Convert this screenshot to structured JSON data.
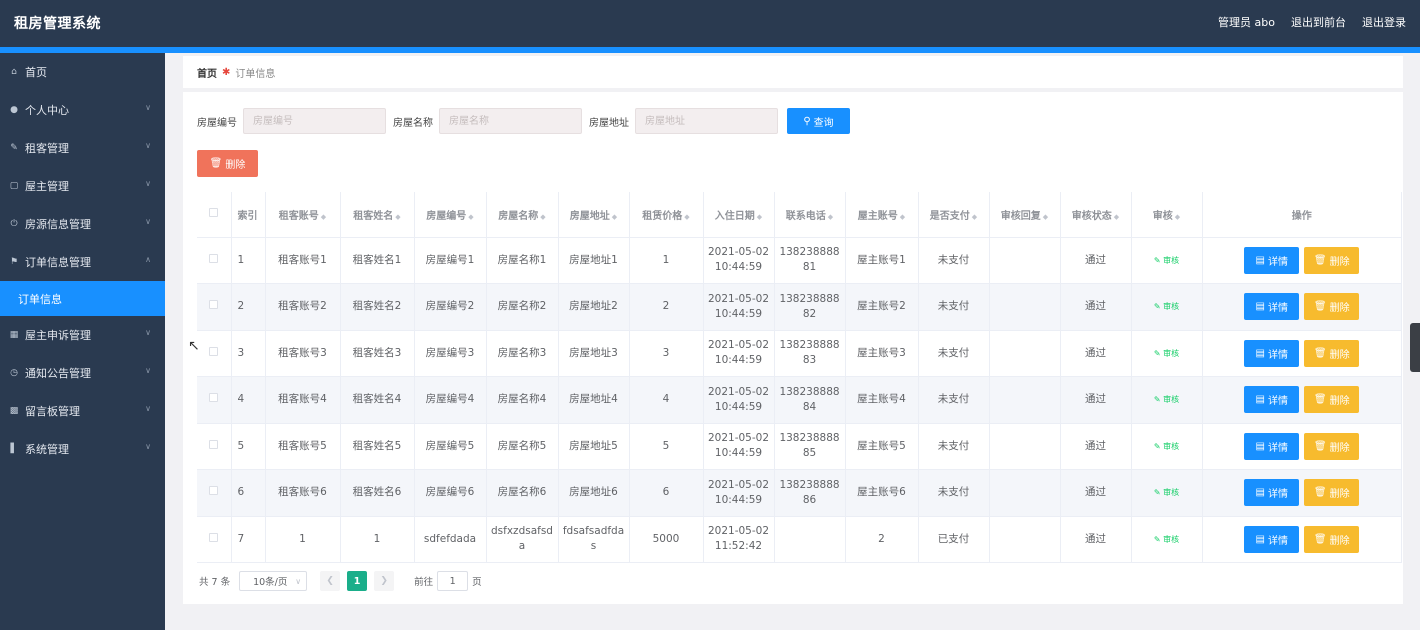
{
  "app": {
    "title": "租房管理系统"
  },
  "topbar": {
    "user": "管理员 abo",
    "to_front": "退出到前台",
    "logout": "退出登录"
  },
  "sidebar": {
    "items": [
      {
        "label": "首页",
        "icon": "home-icon"
      },
      {
        "label": "个人中心",
        "icon": "user-icon"
      },
      {
        "label": "租客管理",
        "icon": "pen-icon"
      },
      {
        "label": "屋主管理",
        "icon": "chat-icon"
      },
      {
        "label": "房源信息管理",
        "icon": "power-icon"
      },
      {
        "label": "订单信息管理",
        "icon": "flag-icon"
      },
      {
        "label": "屋主申诉管理",
        "icon": "grid-icon"
      },
      {
        "label": "通知公告管理",
        "icon": "clock-icon"
      },
      {
        "label": "留言板管理",
        "icon": "board-icon"
      },
      {
        "label": "系统管理",
        "icon": "chart-icon"
      }
    ],
    "active_sub": "订单信息"
  },
  "breadcrumb": {
    "home": "首页",
    "current": "订单信息"
  },
  "search": {
    "f1_label": "房屋编号",
    "f1_placeholder": "房屋编号",
    "f2_label": "房屋名称",
    "f2_placeholder": "房屋名称",
    "f3_label": "房屋地址",
    "f3_placeholder": "房屋地址",
    "query_label": "查询"
  },
  "delete_label": "删除",
  "table": {
    "headers": [
      "索引",
      "租客账号",
      "租客姓名",
      "房屋编号",
      "房屋名称",
      "房屋地址",
      "租赁价格",
      "入住日期",
      "联系电话",
      "屋主账号",
      "是否支付",
      "审核回复",
      "审核状态",
      "审核",
      "操作"
    ],
    "audit_label": "审核",
    "detail_label": "详情",
    "delete_label": "删除",
    "rows": [
      [
        "1",
        "租客账号1",
        "租客姓名1",
        "房屋编号1",
        "房屋名称1",
        "房屋地址1",
        "1",
        "2021-05-02 10:44:59",
        "13823888881",
        "屋主账号1",
        "未支付",
        "",
        "通过"
      ],
      [
        "2",
        "租客账号2",
        "租客姓名2",
        "房屋编号2",
        "房屋名称2",
        "房屋地址2",
        "2",
        "2021-05-02 10:44:59",
        "13823888882",
        "屋主账号2",
        "未支付",
        "",
        "通过"
      ],
      [
        "3",
        "租客账号3",
        "租客姓名3",
        "房屋编号3",
        "房屋名称3",
        "房屋地址3",
        "3",
        "2021-05-02 10:44:59",
        "13823888883",
        "屋主账号3",
        "未支付",
        "",
        "通过"
      ],
      [
        "4",
        "租客账号4",
        "租客姓名4",
        "房屋编号4",
        "房屋名称4",
        "房屋地址4",
        "4",
        "2021-05-02 10:44:59",
        "13823888884",
        "屋主账号4",
        "未支付",
        "",
        "通过"
      ],
      [
        "5",
        "租客账号5",
        "租客姓名5",
        "房屋编号5",
        "房屋名称5",
        "房屋地址5",
        "5",
        "2021-05-02 10:44:59",
        "13823888885",
        "屋主账号5",
        "未支付",
        "",
        "通过"
      ],
      [
        "6",
        "租客账号6",
        "租客姓名6",
        "房屋编号6",
        "房屋名称6",
        "房屋地址6",
        "6",
        "2021-05-02 10:44:59",
        "13823888886",
        "屋主账号6",
        "未支付",
        "",
        "通过"
      ],
      [
        "7",
        "1",
        "1",
        "sdfefdada",
        "dsfxzdsafsda",
        "fdsafsadfdas",
        "5000",
        "2021-05-02 11:52:42",
        "",
        "2",
        "已支付",
        "",
        "通过"
      ]
    ]
  },
  "pager": {
    "total": "共 7 条",
    "size": "10条/页",
    "page": "1",
    "goto": "前往",
    "goto_value": "1",
    "page_unit": "页"
  },
  "colors": {
    "topbar": "#2a3a50",
    "accent": "#1890ff",
    "danger": "#f0735b",
    "warning": "#f7bb2e",
    "pager_active": "#1aae8a"
  }
}
